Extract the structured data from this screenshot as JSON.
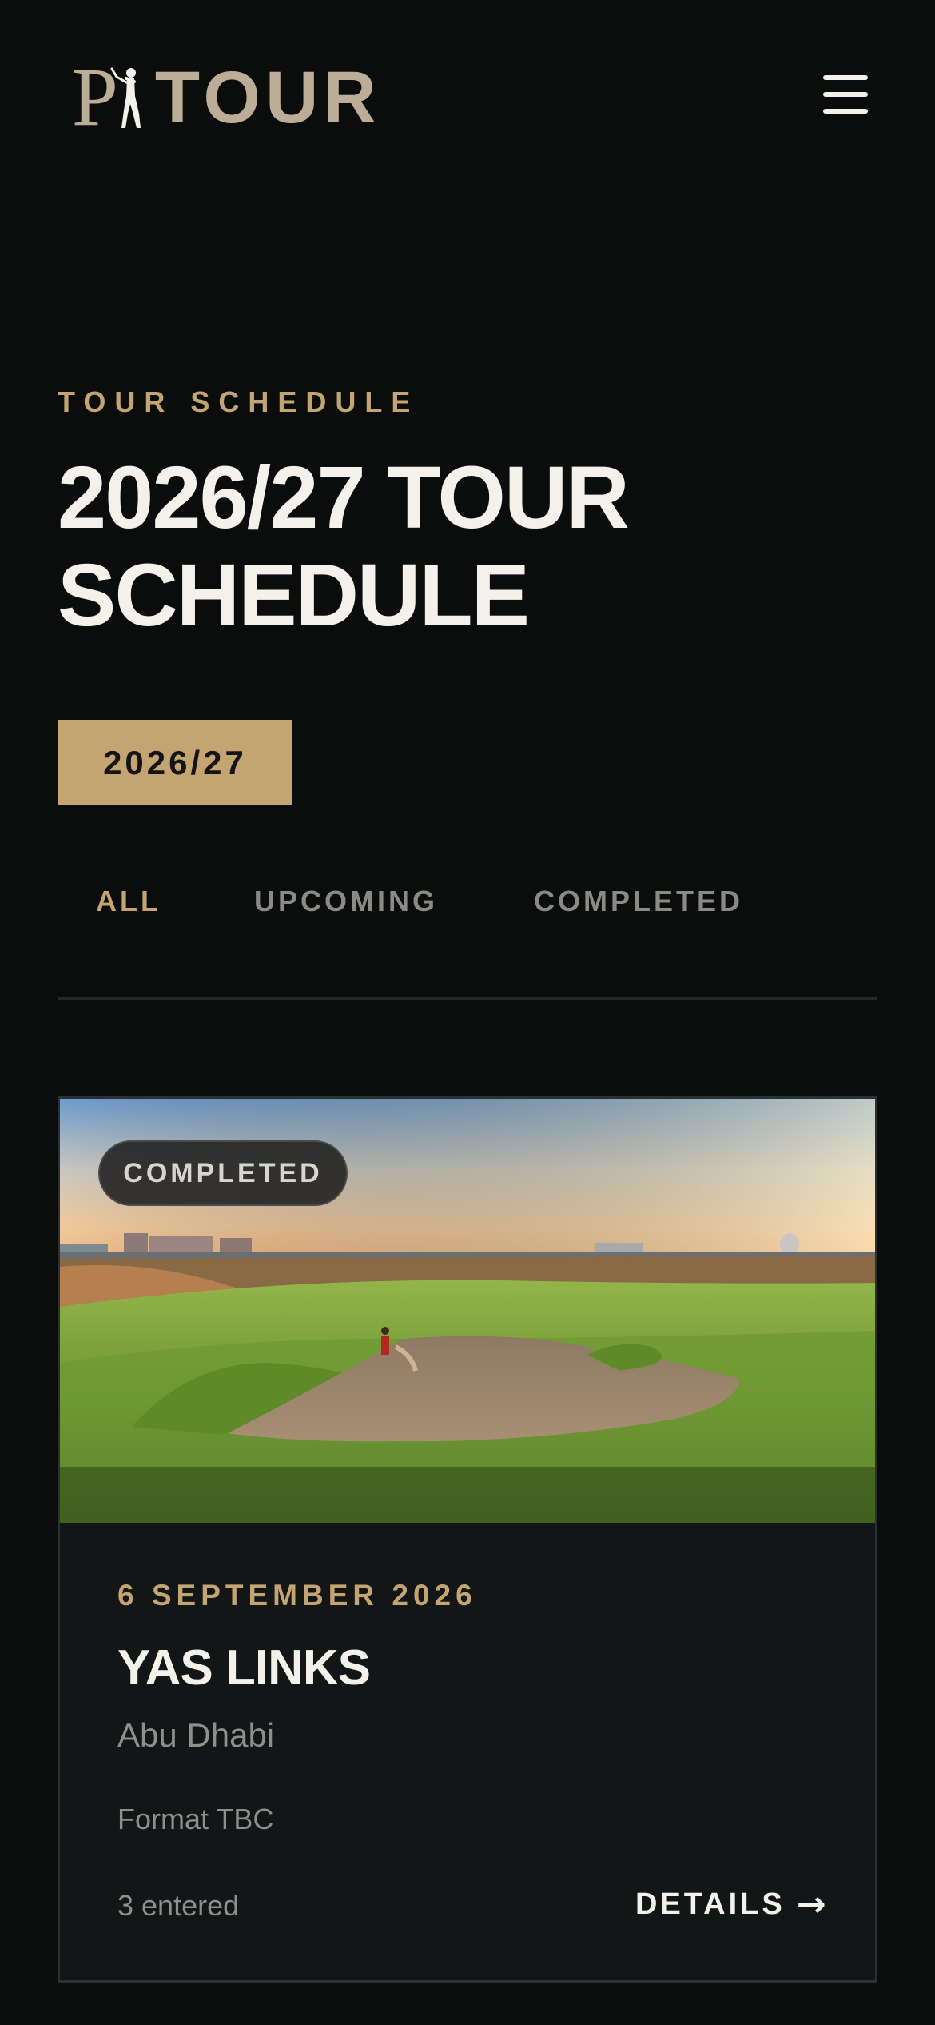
{
  "header": {
    "logo_letter": "P",
    "logo_text": "TOUR",
    "menu_icon": "hamburger-menu-icon"
  },
  "hero": {
    "eyebrow": "TOUR SCHEDULE",
    "title_line1": "2026/27 TOUR",
    "title_line2": "SCHEDULE",
    "season_label": "2026/27"
  },
  "tabs": [
    {
      "label": "ALL",
      "active": true
    },
    {
      "label": "UPCOMING",
      "active": false
    },
    {
      "label": "COMPLETED",
      "active": false
    }
  ],
  "events": [
    {
      "status": "COMPLETED",
      "date": "6 SEPTEMBER 2026",
      "name": "YAS LINKS",
      "location": "Abu Dhabi",
      "format": "Format TBC",
      "entered": "3 entered",
      "details_label": "DETAILS",
      "details_icon": "arrow-right-icon"
    }
  ],
  "colors": {
    "background": "#0b0d0d",
    "accent_gold": "#c4a572",
    "logo": "#bcae96",
    "card": "#121616",
    "muted_text": "#8f8f8b"
  }
}
